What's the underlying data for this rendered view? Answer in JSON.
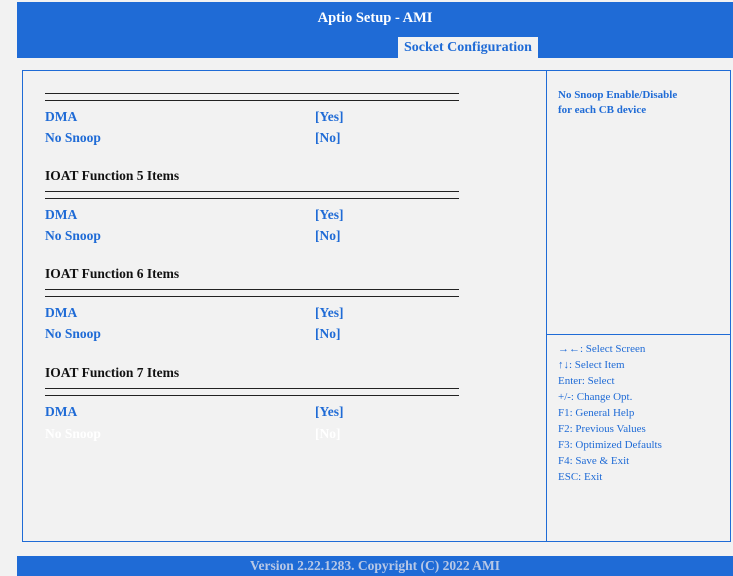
{
  "title": "Aptio Setup  - AMI",
  "active_tab": "Socket Configuration",
  "separator": "==========================================",
  "menu": {
    "group1": {
      "dma_label": "DMA",
      "dma_value": "[Yes]",
      "snoop_label": "No Snoop",
      "snoop_value": "[No]"
    },
    "group5": {
      "heading": "IOAT Function 5 Items",
      "dma_label": "DMA",
      "dma_value": "[Yes]",
      "snoop_label": "No Snoop",
      "snoop_value": "[No]"
    },
    "group6": {
      "heading": "IOAT Function 6 Items",
      "dma_label": "DMA",
      "dma_value": "[Yes]",
      "snoop_label": "No Snoop",
      "snoop_value": "[No]"
    },
    "group7": {
      "heading": "IOAT Function 7 Items",
      "dma_label": "DMA",
      "dma_value": "[Yes]",
      "snoop_label": "No Snoop",
      "snoop_value": "[No]"
    }
  },
  "help": {
    "line1": "No Snoop Enable/Disable",
    "line2": "for each CB device"
  },
  "keys": [
    "→←: Select Screen",
    "↑↓: Select Item",
    "Enter: Select",
    "+/-: Change Opt.",
    "F1: General Help",
    "F2: Previous Values",
    "F3: Optimized Defaults",
    "F4: Save & Exit",
    "ESC: Exit"
  ],
  "footer": "Version 2.22.1283. Copyright (C) 2022 AMI",
  "colors": {
    "accent": "#1f6bd6",
    "background": "#f2f2f2",
    "selected_text": "#ffffff"
  }
}
